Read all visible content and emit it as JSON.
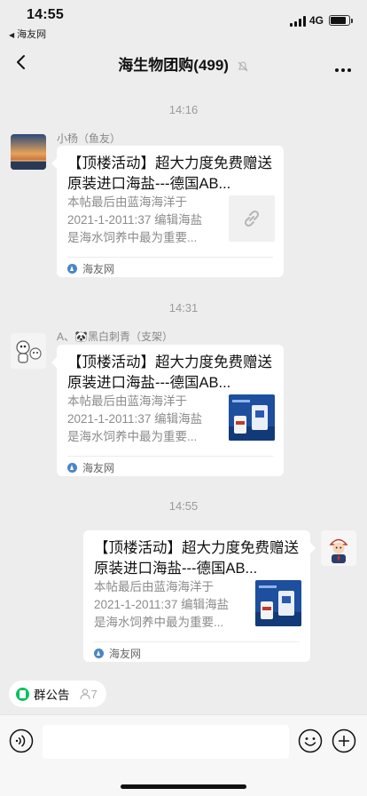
{
  "status_bar": {
    "time": "14:55",
    "back_app": "海友网",
    "network": "4G",
    "battery_level": 0.85
  },
  "nav": {
    "title": "海生物团购(499)"
  },
  "messages": [
    {
      "time": "14:16",
      "sender": "小杨（鱼友）",
      "title": "【顶楼活动】超大力度免费赠送原装进口海盐---德国AB...",
      "desc": "本帖最后由蓝海海洋于 2021-1-2011:37 编辑海盐是海水饲养中最为重要...",
      "source": "海友网",
      "thumb": "link-icon"
    },
    {
      "time": "14:31",
      "sender": "A、🐼黑白刺青（支架）",
      "title": "【顶楼活动】超大力度免费赠送原装进口海盐---德国AB...",
      "desc": "本帖最后由蓝海海洋于 2021-1-2011:37 编辑海盐是海水饲养中最为重要...",
      "source": "海友网",
      "thumb": "product-image"
    },
    {
      "time": "14:55",
      "sender": "",
      "title": "【顶楼活动】超大力度免费赠送原装进口海盐---德国AB...",
      "desc": "本帖最后由蓝海海洋于 2021-1-2011:37 编辑海盐是海水饲养中最为重要...",
      "source": "海友网",
      "thumb": "product-image"
    }
  ],
  "notice": {
    "label": "群公告",
    "count": "7"
  },
  "colors": {
    "background": "#ededed",
    "accent_green": "#07c160",
    "source_blue": "#4a86c5"
  }
}
